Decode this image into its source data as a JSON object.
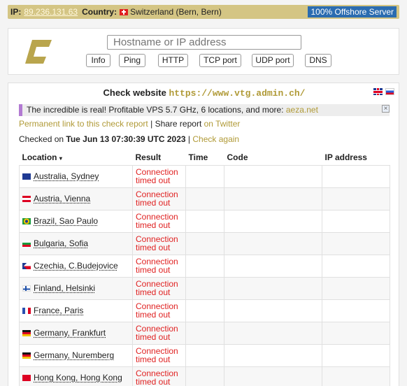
{
  "topbar": {
    "ip_label": "IP:",
    "ip": "89.236.131.63",
    "country_label": "Country:",
    "country": "Switzerland (Bern, Bern)",
    "offshore": "100% Offshore Server"
  },
  "toolbox": {
    "search_placeholder": "Hostname or IP address",
    "buttons": [
      "Info",
      "Ping",
      "HTTP",
      "TCP port",
      "UDP port",
      "DNS"
    ]
  },
  "main": {
    "heading_prefix": "Check website",
    "heading_url": "https://www.vtg.admin.ch/",
    "ad_text": "The incredible is real! Profitable VPS 5.7 GHz, 6 locations, and more:",
    "ad_link": "aeza.net",
    "ad_close": "×",
    "permalink": "Permanent link to this check report",
    "separator": "|",
    "share_prefix": "Share report",
    "share_link": "on Twitter",
    "checked_prefix": "Checked on",
    "checked_date": "Tue Jun 13 07:30:39 UTC 2023",
    "check_again": "Check again"
  },
  "table": {
    "headers": {
      "location": "Location",
      "sort_icon": "▾",
      "result": "Result",
      "time": "Time",
      "code": "Code",
      "ip": "IP address"
    },
    "rows": [
      {
        "flag": "au",
        "location": "Australia, Sydney",
        "result_line1": "Connection",
        "result_line2": "timed out"
      },
      {
        "flag": "at",
        "location": "Austria, Vienna",
        "result_line1": "Connection",
        "result_line2": "timed out"
      },
      {
        "flag": "br",
        "location": "Brazil, Sao Paulo",
        "result_line1": "Connection",
        "result_line2": "timed out"
      },
      {
        "flag": "bg",
        "location": "Bulgaria, Sofia",
        "result_line1": "Connection",
        "result_line2": "timed out"
      },
      {
        "flag": "cz",
        "location": "Czechia, C.Budejovice",
        "result_line1": "Connection",
        "result_line2": "timed out"
      },
      {
        "flag": "fi",
        "location": "Finland, Helsinki",
        "result_line1": "Connection",
        "result_line2": "timed out"
      },
      {
        "flag": "fr",
        "location": "France, Paris",
        "result_line1": "Connection",
        "result_line2": "timed out"
      },
      {
        "flag": "de",
        "location": "Germany, Frankfurt",
        "result_line1": "Connection",
        "result_line2": "timed out"
      },
      {
        "flag": "de",
        "location": "Germany, Nuremberg",
        "result_line1": "Connection",
        "result_line2": "timed out"
      },
      {
        "flag": "hk",
        "location": "Hong Kong, Hong Kong",
        "result_line1": "Connection",
        "result_line2": "timed out"
      }
    ]
  }
}
